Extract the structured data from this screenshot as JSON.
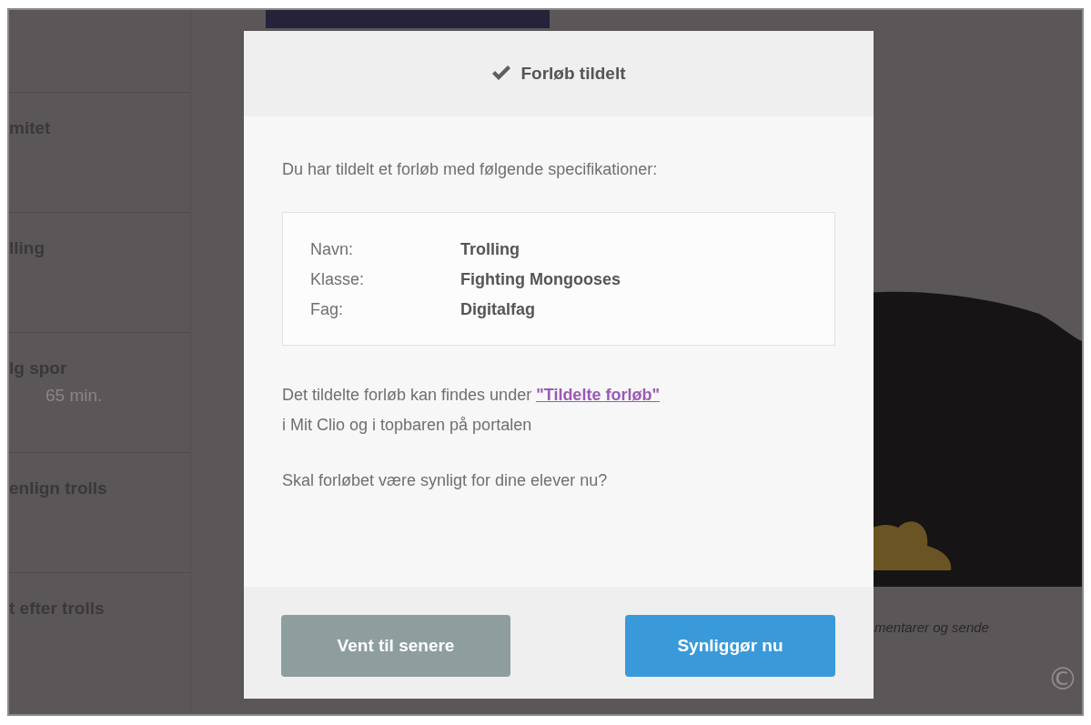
{
  "sidebar": {
    "items": [
      {
        "title": "mitet"
      },
      {
        "title": "lling"
      },
      {
        "title": "lg spor",
        "subtitle": "65 min."
      },
      {
        "title": "enlign trolls"
      },
      {
        "title": "t efter trolls"
      }
    ]
  },
  "content": {
    "caption": "mentarer og sende",
    "copyright_mark": "©"
  },
  "modal": {
    "title": "Forløb tildelt",
    "intro": "Du har tildelt et forløb med følgende specifikationer:",
    "specs": [
      {
        "label": "Navn:",
        "value": "Trolling"
      },
      {
        "label": "Klasse:",
        "value": "Fighting Mongooses"
      },
      {
        "label": "Fag:",
        "value": "Digitalfag"
      }
    ],
    "info": {
      "before": "Det tildelte forløb kan findes under",
      "link": "\"Tildelte forløb\"",
      "after": "i Mit Clio og i topbaren på portalen"
    },
    "question": "Skal forløbet være synligt for dine elever nu?",
    "buttons": [
      {
        "label": "Vent til senere",
        "kind": "secondary"
      },
      {
        "label": "Synliggør nu",
        "kind": "primary"
      }
    ]
  }
}
